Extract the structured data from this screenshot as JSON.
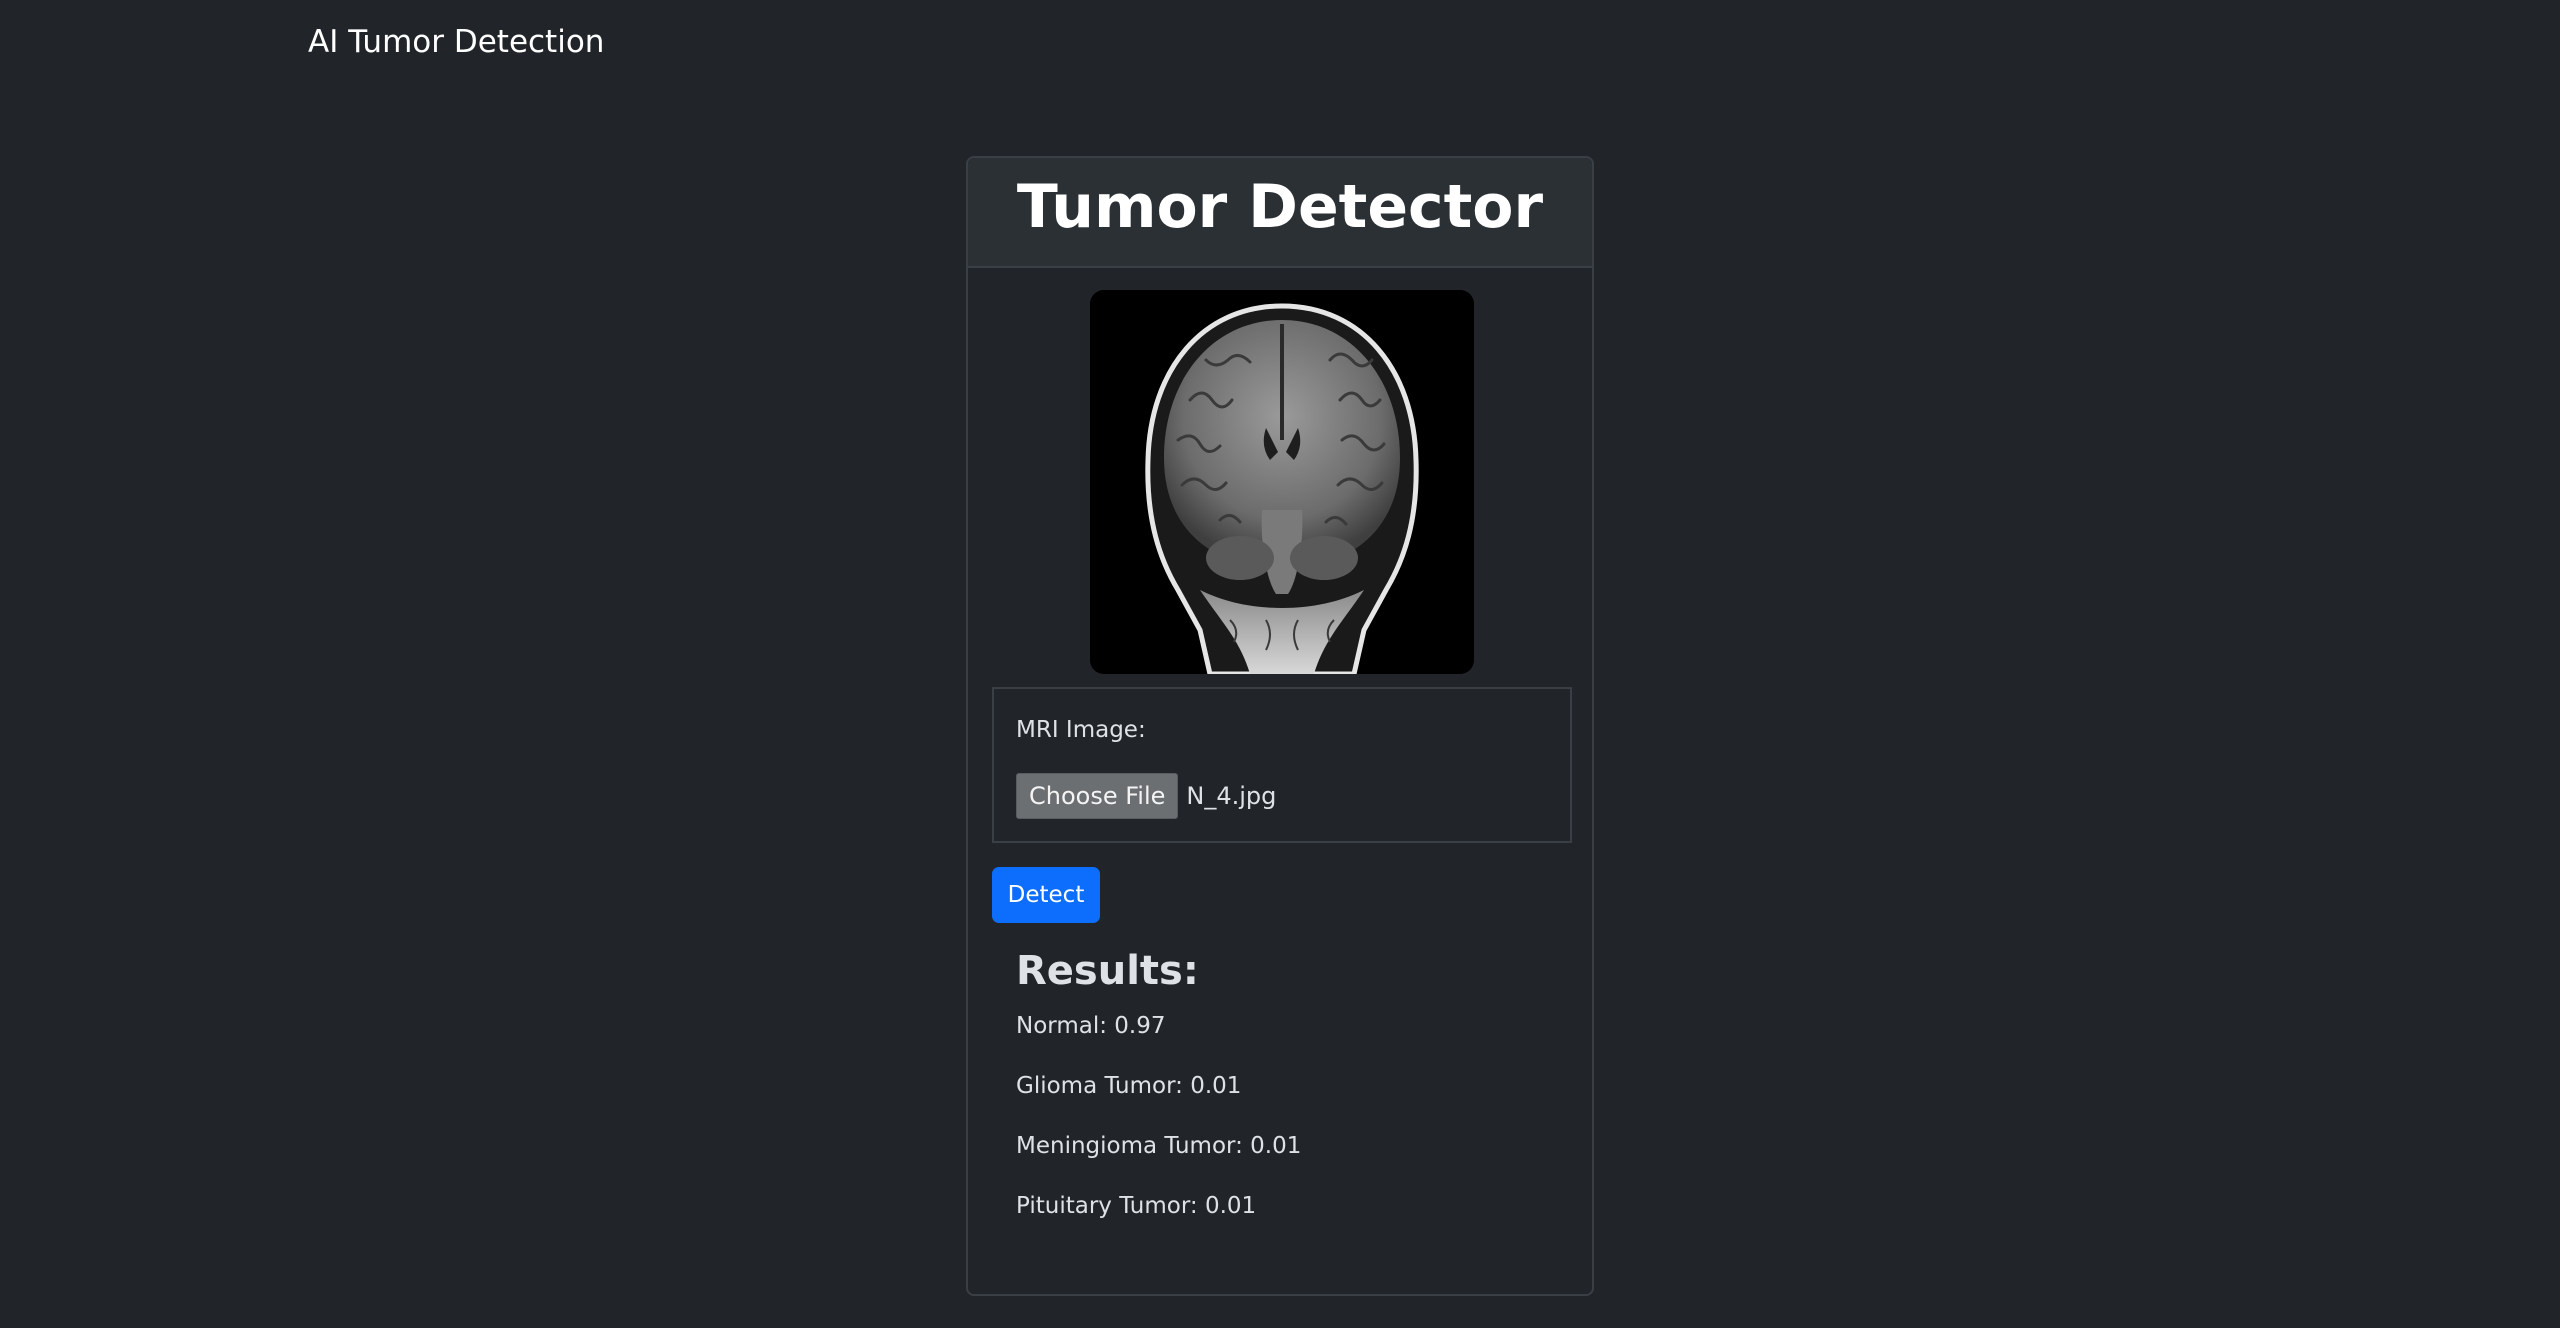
{
  "navbar": {
    "brand": "AI Tumor Detection"
  },
  "card": {
    "title": "Tumor Detector",
    "form": {
      "label": "MRI Image:",
      "file_button_label": "Choose File",
      "file_name": "N_4.jpg"
    },
    "detect_label": "Detect",
    "results": {
      "title": "Results:",
      "items": [
        "Normal: 0.97",
        "Glioma Tumor: 0.01",
        "Meningioma Tumor: 0.01",
        "Pituitary Tumor: 0.01"
      ]
    }
  },
  "colors": {
    "background": "#212529",
    "header": "#2b3035",
    "primary_button": "#0d6efd"
  }
}
